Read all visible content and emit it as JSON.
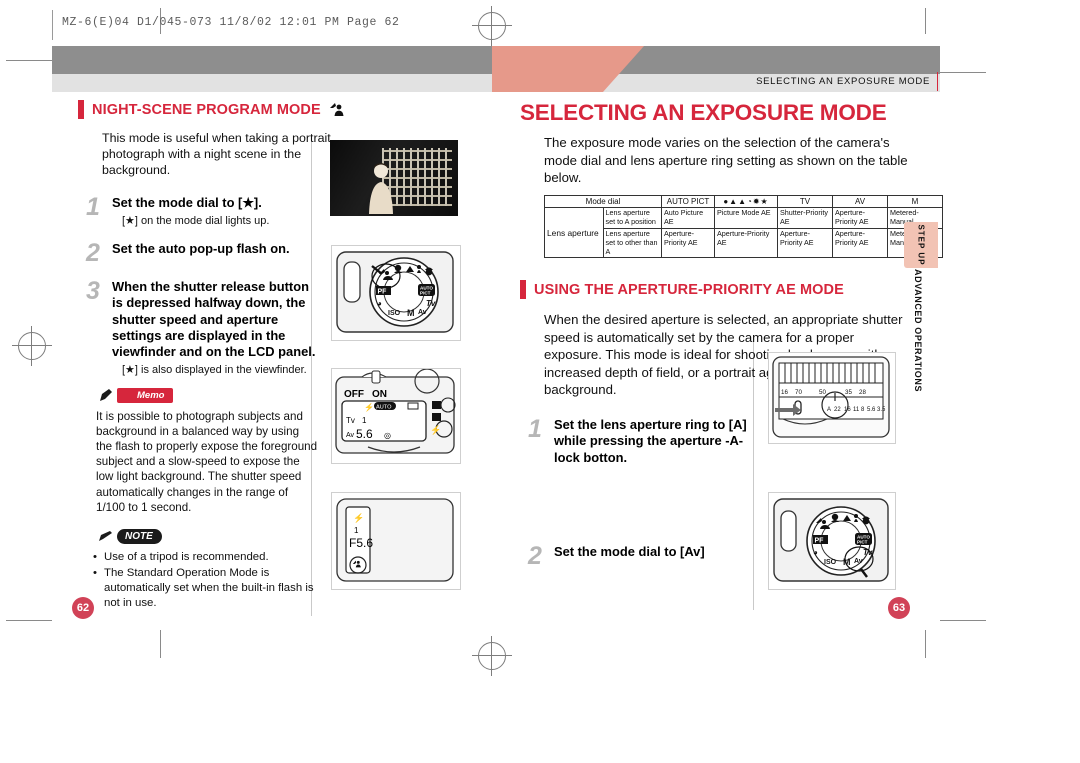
{
  "file_info": "MZ-6(E)04 D1/045-073   11/8/02 12:01 PM   Page 62",
  "banner": {
    "running_title": "SELECTING AN EXPOSURE MODE"
  },
  "side_tab": {
    "step_up": "STEP UP",
    "chapter": "ADVANCED OPERATIONS"
  },
  "left_page": {
    "number": "62",
    "section_title": "NIGHT-SCENE PROGRAM MODE",
    "section_icon": "night-scene-icon",
    "intro": "This mode is useful when taking a portrait photograph with a night scene in the background.",
    "steps": [
      {
        "num": "1",
        "title": "Set the mode dial to [ ★ ].",
        "sub": "[ ★ ] on the mode dial lights up."
      },
      {
        "num": "2",
        "title": "Set the auto pop-up flash on.",
        "sub": ""
      },
      {
        "num": "3",
        "title": "When the shutter release button is depressed halfway down, the shutter speed and aperture settings are displayed in the viewfinder and on the LCD panel.",
        "sub": "[ ★ ] is also displayed in the viewfinder."
      }
    ],
    "memo": {
      "label": "Memo",
      "text": "It is possible to photograph subjects and background in a balanced way by using the flash to properly expose the foreground subject and a slow-speed to expose the low light background. The shutter speed automatically changes in the range of 1/100 to 1 second."
    },
    "note": {
      "label": "NOTE",
      "items": [
        "Use of a tripod is recommended.",
        "The Standard Operation Mode is automatically set when the built-in flash is not in use."
      ]
    },
    "figures": {
      "photo_caption": "night-scene-sample-photo",
      "mode_dial": "mode-dial-illustration",
      "lcd_panel": "lcd-panel-illustration",
      "viewfinder": "viewfinder-illustration",
      "lcd_texts": {
        "off": "OFF",
        "on": "ON",
        "tv": "Tv",
        "av": "Av",
        "aperture": "5.6",
        "auto_flash": "AUTO"
      },
      "viewfinder_texts": {
        "aperture": "F5.6"
      }
    }
  },
  "right_page": {
    "number": "63",
    "main_title": "SELECTING AN EXPOSURE MODE",
    "main_intro": "The exposure mode varies on the selection of the camera's mode dial and lens aperture ring setting as shown on the table below.",
    "section_title": "USING THE APERTURE-PRIORITY AE MODE",
    "section_intro": "When the desired aperture is selected, an appropriate shutter speed is automatically set by the camera for a proper exposure. This mode is ideal for shooting landscapes with increased depth of field, or a portrait against a blurred background.",
    "steps": [
      {
        "num": "1",
        "title": "Set the lens aperture ring to [A] while pressing the aperture -A- lock botton."
      },
      {
        "num": "2",
        "title": "Set the mode dial to [Av]"
      }
    ],
    "figures": {
      "lens_ring": "lens-aperture-ring-illustration",
      "mode_dial": "mode-dial-av-illustration",
      "lens_scale": [
        "16",
        "70",
        "50",
        "35",
        "28"
      ],
      "aperture_scale": [
        "A",
        "22",
        "16",
        "11",
        "8",
        "5.6",
        "3.5"
      ]
    }
  },
  "exposure_table": {
    "corner_label": "Mode dial",
    "row_group_label": "Lens aperture",
    "columns": [
      "AUTO PICT",
      "picture-mode-icons",
      "TV",
      "AV",
      "M"
    ],
    "rows": [
      {
        "label": "Lens aperture set to A position",
        "cells": [
          "Auto Picture AE",
          "Picture Mode AE",
          "Shutter-Priority AE",
          "Aperture-Priority AE",
          "Metered-Manual"
        ]
      },
      {
        "label": "Lens aperture set to other than A",
        "cells": [
          "Aperture-Priority AE",
          "Aperture-Priority AE",
          "Aperture-Priority AE",
          "Aperture-Priority AE",
          "Metered-Manual"
        ]
      }
    ]
  },
  "colors": {
    "accent_red": "#d6263c",
    "banner_gray": "#8e8e8e",
    "salmon": "#e6998a",
    "page_badge": "#d14257"
  }
}
